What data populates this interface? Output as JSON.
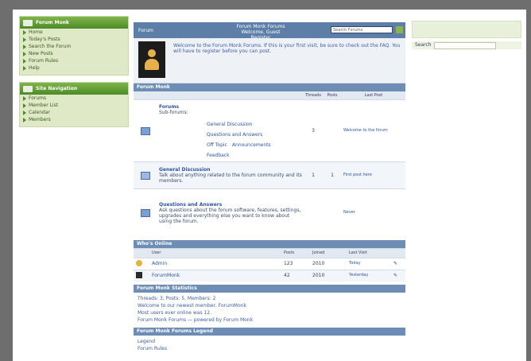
{
  "left_panel": {
    "box1": {
      "title": "Forum Monk",
      "items": [
        "Home",
        "Today's Posts",
        "Search the Forum",
        "New Posts",
        "Forum Rules",
        "Help"
      ]
    },
    "box2": {
      "title": "Site Navigation",
      "items": [
        "Forums",
        "Member List",
        "Calendar",
        "Members"
      ]
    }
  },
  "header": {
    "left_text": "Forum",
    "center_lines": [
      "Forum Monk Forums",
      "Welcome, Guest",
      "Register"
    ],
    "search_placeholder": "Search Forums"
  },
  "user": {
    "message": "Welcome to the Forum Monk Forums. If this is your first visit, be sure to check out the FAQ. You will have to register before you can post."
  },
  "forum_section": {
    "title": "Forum Monk",
    "columns": [
      "Threads",
      "Posts",
      "Last Post"
    ],
    "rows": [
      {
        "title": "Forums",
        "desc": "Sub-forums:",
        "subforums": [
          "General Discussion",
          "Questions and Answers",
          "Off Topic",
          "Announcements",
          "Feedback"
        ],
        "threads": "3",
        "posts": "",
        "last_post": "Welcome to the forum"
      },
      {
        "title": "General Discussion",
        "desc": "Talk about anything related to the forum community and its members.",
        "threads": "1",
        "posts": "1",
        "last_post": "First post here"
      },
      {
        "title": "Questions and Answers",
        "desc": "Ask questions about the forum software, features, settings, upgrades and everything else you want to know about using the forum.",
        "threads": "",
        "posts": "",
        "last_post": "Never"
      }
    ]
  },
  "online": {
    "title": "Who's Online",
    "columns": [
      "User",
      "Posts",
      "Joined",
      "Last Visit",
      ""
    ],
    "rows": [
      {
        "user": "Admin",
        "posts": "123",
        "joined": "2010",
        "last": "Today"
      },
      {
        "user": "ForumMonk",
        "posts": "42",
        "joined": "2010",
        "last": "Yesterday"
      }
    ]
  },
  "info": {
    "title": "Forum Monk Statistics",
    "lines": [
      "Threads: 3, Posts: 5, Members: 2",
      "Welcome to our newest member, ForumMonk",
      "Most users ever online was 12.",
      "Forum Monk Forums — powered by Forum Monk"
    ]
  },
  "footer_bar": {
    "title": "Forum Monk Forums Legend"
  },
  "footer_lines": [
    "Legend",
    "Forum Rules"
  ],
  "right_panel": {
    "label": "Search"
  }
}
